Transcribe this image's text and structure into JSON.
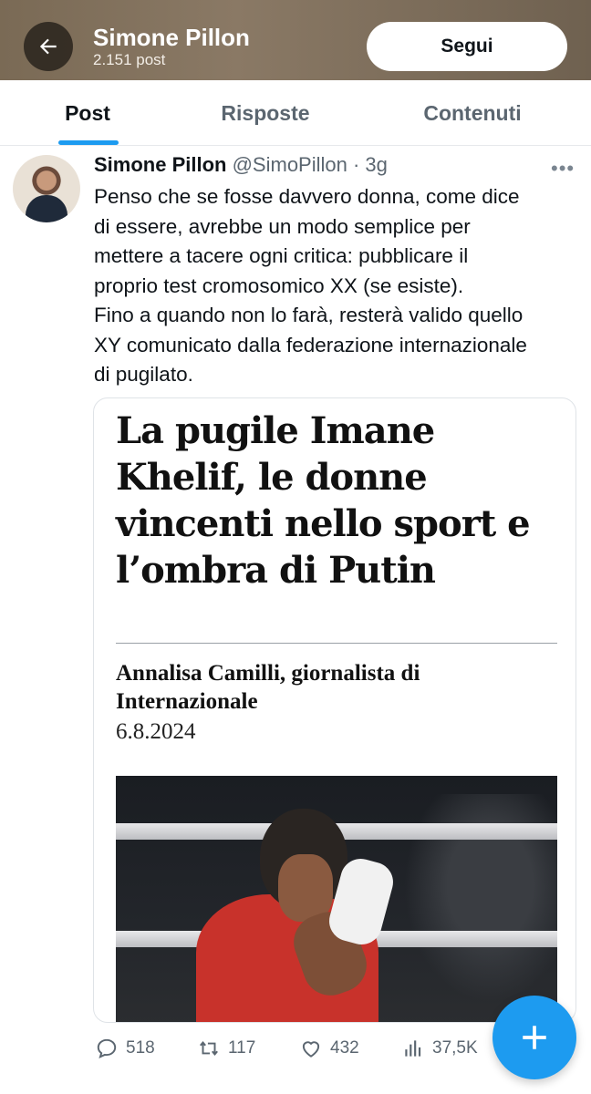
{
  "header": {
    "title": "Simone Pillon",
    "post_count": "2.151 post",
    "follow_label": "Segui",
    "back_icon": "arrow-left-icon",
    "background_color": "#7a6a55"
  },
  "tabs": [
    {
      "label": "Post",
      "active": true
    },
    {
      "label": "Risposte",
      "active": false
    },
    {
      "label": "Contenuti",
      "active": false
    }
  ],
  "accent_color": "#1d9bf0",
  "tweet": {
    "author_name": "Simone Pillon",
    "handle": "@SimoPillon",
    "time": "· 3g",
    "more_icon": "more-horizontal-icon",
    "text": "Penso che se fosse davvero donna, come dice\ndi essere, avrebbe un modo semplice per\nmettere a tacere ogni critica: pubblicare il\nproprio test cromosomico XX (se esiste).\nFino a quando non lo farà, resterà valido quello\nXY comunicato dalla federazione internazionale\ndi pugilato.",
    "card": {
      "headline": "La pugile Imane\nKhelif, le donne\nvincenti nello sport e\nl’ombra di Putin",
      "byline": "Annalisa Camilli, giornalista di\nInternazionale",
      "date": "6.8.2024"
    },
    "stats": {
      "replies": "518",
      "retweets": "117",
      "likes": "432",
      "views": "37,5K"
    }
  },
  "fab_icon": "plus-icon"
}
